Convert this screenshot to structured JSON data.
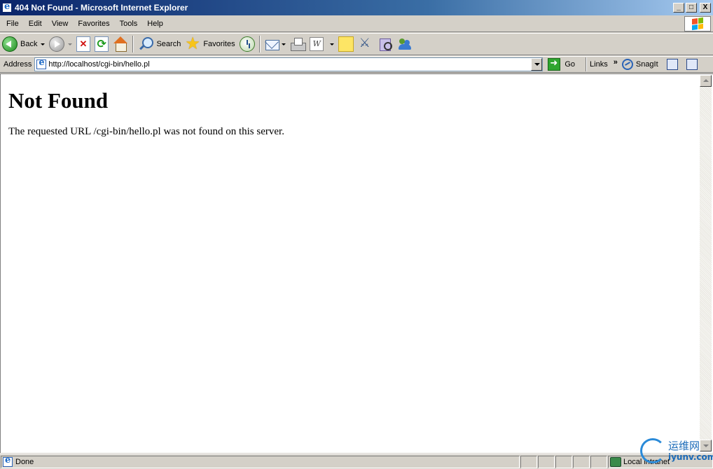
{
  "window": {
    "title": "404 Not Found - Microsoft Internet Explorer",
    "controls": [
      "_",
      "□",
      "X"
    ]
  },
  "menu": [
    "File",
    "Edit",
    "View",
    "Favorites",
    "Tools",
    "Help"
  ],
  "toolbar": {
    "back_label": "Back",
    "search_label": "Search",
    "favorites_label": "Favorites"
  },
  "address": {
    "label": "Address",
    "url": "http://localhost/cgi-bin/hello.pl",
    "go_label": "Go",
    "links_label": "Links",
    "chevron": "»",
    "snagit_label": "SnagIt"
  },
  "page": {
    "heading": "Not Found",
    "message": "The requested URL /cgi-bin/hello.pl was not found on this server."
  },
  "status": {
    "text": "Done",
    "zone": "Local intranet"
  },
  "watermark": {
    "cn": "运维网",
    "url": "iyunv.com"
  },
  "icons": {
    "back": "back-arrow-icon",
    "forward": "forward-arrow-icon",
    "stop": "stop-icon",
    "refresh": "refresh-icon",
    "home": "home-icon",
    "search": "search-icon",
    "favorites": "favorites-star-icon",
    "history": "history-icon",
    "mail": "mail-icon",
    "print": "print-icon",
    "edit": "word-edit-icon",
    "note": "note-icon",
    "messenger": "messenger-icon"
  }
}
